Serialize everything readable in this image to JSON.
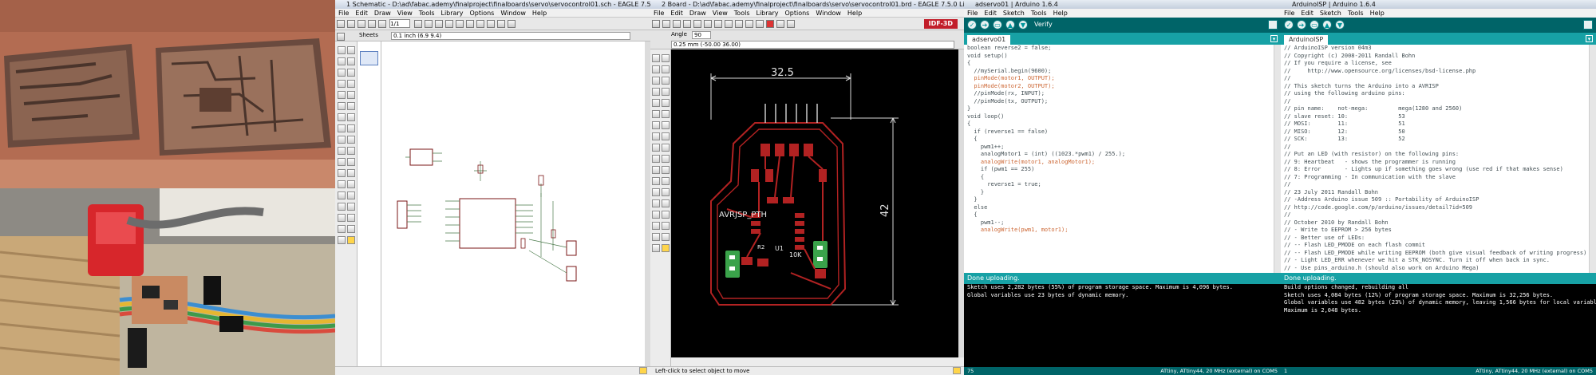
{
  "eagle_schematic": {
    "title": "1 Schematic - D:\\ad\\fabac.ademy\\finalproject\\finalboards\\servo\\servocontrol01.sch - EAGLE 7.5.0 Light",
    "menu": [
      "File",
      "Edit",
      "Draw",
      "View",
      "Tools",
      "Library",
      "Options",
      "Window",
      "Help"
    ],
    "sheet_input": "0.1 inch (6.9 9.4)",
    "sheets_label": "Sheets",
    "zoom_value": "1/1"
  },
  "eagle_board": {
    "title": "2 Board - D:\\ad\\fabac.ademy\\finalproject\\finalboards\\servo\\servocontrol01.brd - EAGLE 7.5.0 Light",
    "menu": [
      "File",
      "Edit",
      "Draw",
      "View",
      "Tools",
      "Library",
      "Options",
      "Window",
      "Help"
    ],
    "angle_label": "Angle",
    "angle_value": "90",
    "coord_input": "0.25 mm (-50.00 36.00)",
    "brand_label": "IDF-3D",
    "status_text": "Left-click to select object to move",
    "dim_width": "32.5",
    "dim_height": "42",
    "board_label": "AVRJSP_PTH",
    "part_labels": [
      "U1",
      "R2",
      "10K"
    ]
  },
  "arduino_left": {
    "title": "adservo01 | Arduino 1.6.4",
    "menu": [
      "File",
      "Edit",
      "Sketch",
      "Tools",
      "Help"
    ],
    "toolbar_hint": "Verify",
    "tab": "adservo01",
    "code": [
      "boolean reverse2 = false;",
      "",
      "void setup()",
      "{",
      "  //mySerial.begin(9600);",
      "",
      "  pinMode(motor1, OUTPUT);",
      "  pinMode(motor2, OUTPUT);",
      "  //pinMode(rx, INPUT);",
      "  //pinMode(tx, OUTPUT);",
      "}",
      "",
      "void loop()",
      "{",
      "",
      "  if (reverse1 == false)",
      "  {",
      "    pwm1++;",
      "    analogMotor1 = (int) ((1023.*pwm1) / 255.);",
      "    analogWrite(motor1, analogMotor1);",
      "    if (pwm1 == 255)",
      "    {",
      "      reverse1 = true;",
      "    }",
      "  }",
      "  else",
      "  {",
      "    pwm1--;",
      "    analogWrite(pwm1, motor1);"
    ],
    "status": "Done uploading.",
    "console": [
      "",
      "",
      "Sketch uses 2,282 bytes (55%) of program storage space. Maximum is 4,096 bytes.",
      "",
      "Global variables use 23 bytes of dynamic memory."
    ],
    "footer_line": "75",
    "footer_board": "ATtiny, ATtiny44, 20 MHz (external) on COM5"
  },
  "arduino_right": {
    "title": "ArduinoISP | Arduino 1.6.4",
    "menu": [
      "File",
      "Edit",
      "Sketch",
      "Tools",
      "Help"
    ],
    "tab": "ArduinoISP",
    "code": [
      "// ArduinoISP version 04m3",
      "// Copyright (c) 2008-2011 Randall Bohn",
      "// If you require a license, see",
      "//     http://www.opensource.org/licenses/bsd-license.php",
      "//",
      "// This sketch turns the Arduino into a AVRISP",
      "// using the following arduino pins:",
      "//",
      "// pin name:    not-mega:         mega(1280 and 2560)",
      "// slave reset: 10:               53",
      "// MOSI:        11:               51",
      "// MISO:        12:               50",
      "// SCK:         13:               52",
      "//",
      "// Put an LED (with resistor) on the following pins:",
      "// 9: Heartbeat   - shows the programmer is running",
      "// 8: Error       - Lights up if something goes wrong (use red if that makes sense)",
      "// 7: Programming - In communication with the slave",
      "//",
      "// 23 July 2011 Randall Bohn",
      "// -Address Arduino issue 509 :: Portability of ArduinoISP",
      "// http://code.google.com/p/arduino/issues/detail?id=509",
      "//",
      "// October 2010 by Randall Bohn",
      "// - Write to EEPROM > 256 bytes",
      "// - Better use of LEDs:",
      "// -- Flash LED_PMODE on each flash commit",
      "// -- Flash LED_PMODE while writing EEPROM (both give visual feedback of writing progress)",
      "// - Light LED_ERR whenever we hit a STK_NOSYNC. Turn it off when back in sync.",
      "// - Use pins_arduino.h (should also work on Arduino Mega)"
    ],
    "status": "Done uploading.",
    "console": [
      "Build options changed, rebuilding all",
      "",
      "",
      "Sketch uses 4,084 bytes (12%) of program storage space. Maximum is 32,256 bytes.",
      "",
      "Global variables use 482 bytes (23%) of dynamic memory, leaving 1,566 bytes for local variables.",
      "Maximum is 2,048 bytes."
    ],
    "footer_line": "1",
    "footer_board": "ATtiny, ATtiny44, 20 MHz (external) on COM5"
  },
  "colors": {
    "arduino_teal": "#00979c",
    "arduino_dark": "#006468",
    "eagle_pad": "#b22222",
    "board_bg": "#000000"
  }
}
